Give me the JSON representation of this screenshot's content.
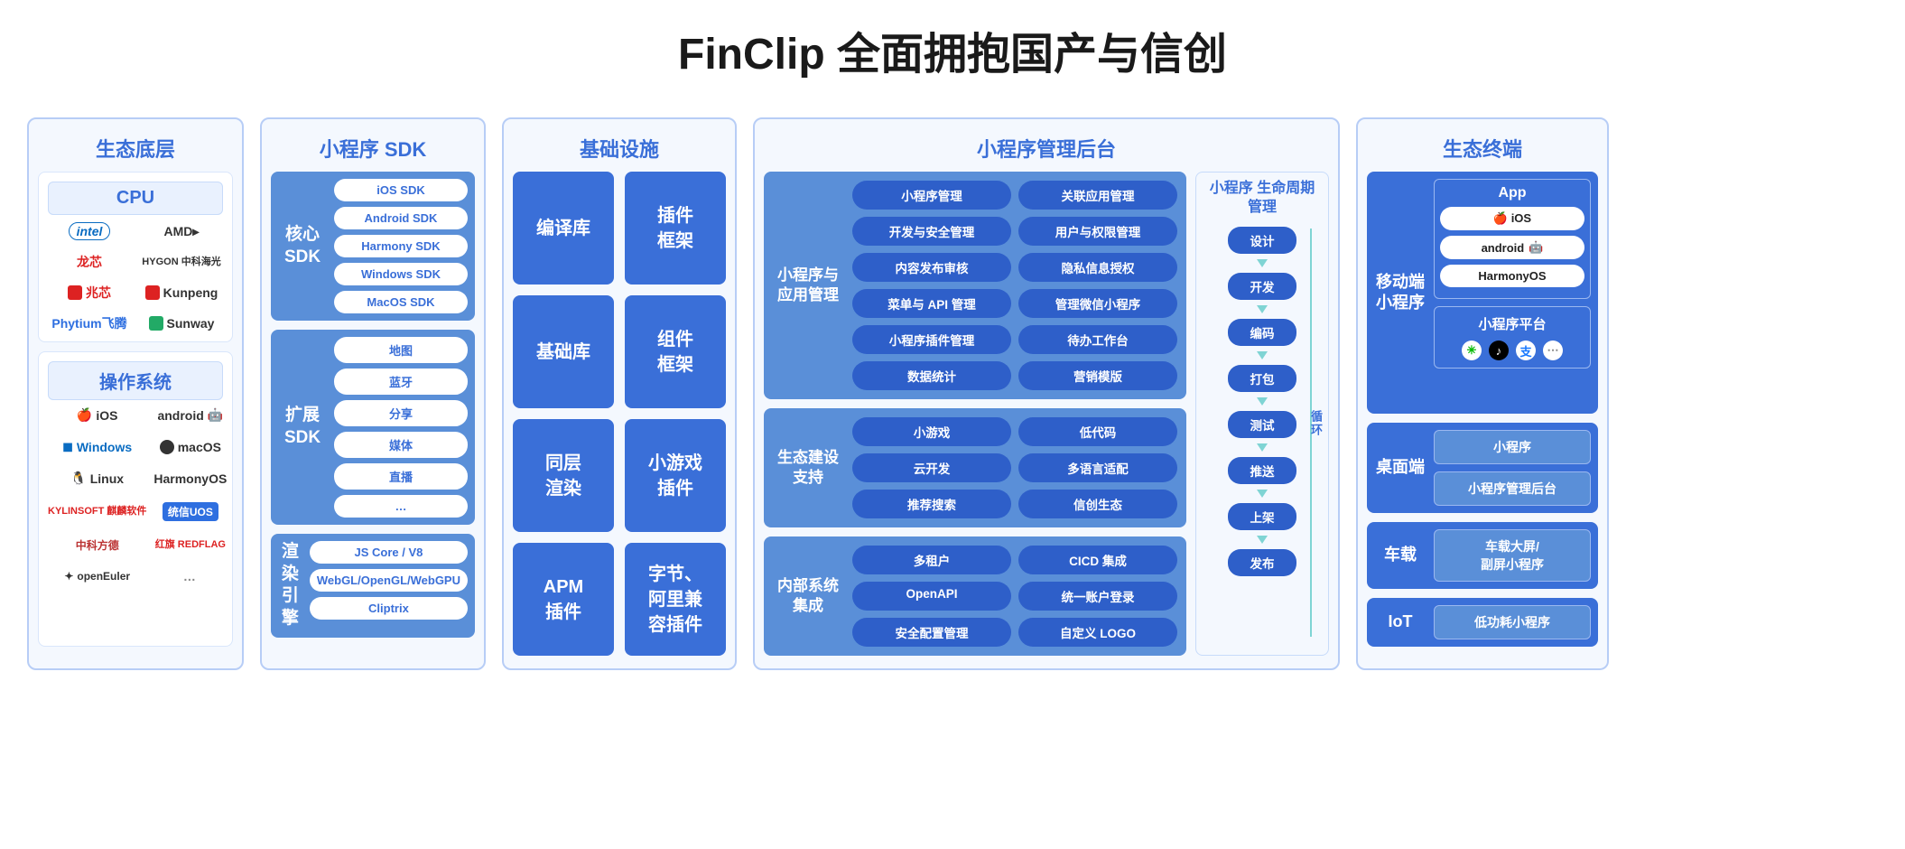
{
  "title": "FinClip 全面拥抱国产与信创",
  "col1": {
    "header": "生态底层",
    "cpu": {
      "title": "CPU",
      "logos": [
        "intel",
        "AMD▸",
        "龙芯",
        "HYGON 中科海光",
        "兆芯",
        "Kunpeng",
        "Phytium飞腾",
        "Sunway"
      ]
    },
    "os": {
      "title": "操作系统",
      "logos": [
        "iOS",
        "android",
        "Windows",
        "macOS",
        "Linux",
        "HarmonyOS",
        "KYLINSOFT 麒麟软件",
        "统信UOS",
        "中科方德",
        "红旗 REDFLAG",
        "openEuler",
        "…"
      ]
    }
  },
  "col2": {
    "header": "小程序 SDK",
    "sections": [
      {
        "label": "核心\nSDK",
        "items": [
          "iOS SDK",
          "Android SDK",
          "Harmony SDK",
          "Windows SDK",
          "MacOS SDK"
        ]
      },
      {
        "label": "扩展\nSDK",
        "items": [
          "地图",
          "蓝牙",
          "分享",
          "媒体",
          "直播",
          "…"
        ]
      },
      {
        "label": "渲染\n引擎",
        "items": [
          "JS Core / V8",
          "WebGL/OpenGL/WebGPU",
          "Cliptrix"
        ]
      }
    ]
  },
  "col3": {
    "header": "基础设施",
    "boxes": [
      "编译库",
      "插件\n框架",
      "基础库",
      "组件\n框架",
      "同层\n渲染",
      "小游戏\n插件",
      "APM\n插件",
      "字节、\n阿里兼\n容插件"
    ]
  },
  "col4": {
    "header": "小程序管理后台",
    "sections": [
      {
        "label": "小程序与\n应用管理",
        "items": [
          "小程序管理",
          "关联应用管理",
          "开发与安全管理",
          "用户与权限管理",
          "内容发布审核",
          "隐私信息授权",
          "菜单与 API 管理",
          "管理微信小程序",
          "小程序插件管理",
          "待办工作台",
          "数据统计",
          "营销模版"
        ]
      },
      {
        "label": "生态建设\n支持",
        "items": [
          "小游戏",
          "低代码",
          "云开发",
          "多语言适配",
          "推荐搜索",
          "信创生态"
        ]
      },
      {
        "label": "内部系统\n集成",
        "items": [
          "多租户",
          "CICD 集成",
          "OpenAPI",
          "统一账户登录",
          "安全配置管理",
          "自定义 LOGO"
        ]
      }
    ],
    "lifecycle": {
      "title": "小程序\n生命周期管理",
      "steps": [
        "设计",
        "开发",
        "编码",
        "打包",
        "测试",
        "推送",
        "上架",
        "发布"
      ],
      "side": "循环"
    }
  },
  "col5": {
    "header": "生态终端",
    "rows": [
      {
        "label": "移动端\n小程序",
        "app_title": "App",
        "os_list": [
          "iOS",
          "android",
          "HarmonyOS"
        ],
        "platform": "小程序平台",
        "icons": [
          "wechat",
          "tiktok",
          "alipay",
          "more"
        ]
      },
      {
        "label": "桌面端",
        "items": [
          "小程序",
          "小程序管理后台"
        ]
      },
      {
        "label": "车载",
        "items": [
          "车载大屏/\n副屏小程序"
        ]
      },
      {
        "label": "IoT",
        "items": [
          "低功耗小程序"
        ]
      }
    ]
  }
}
